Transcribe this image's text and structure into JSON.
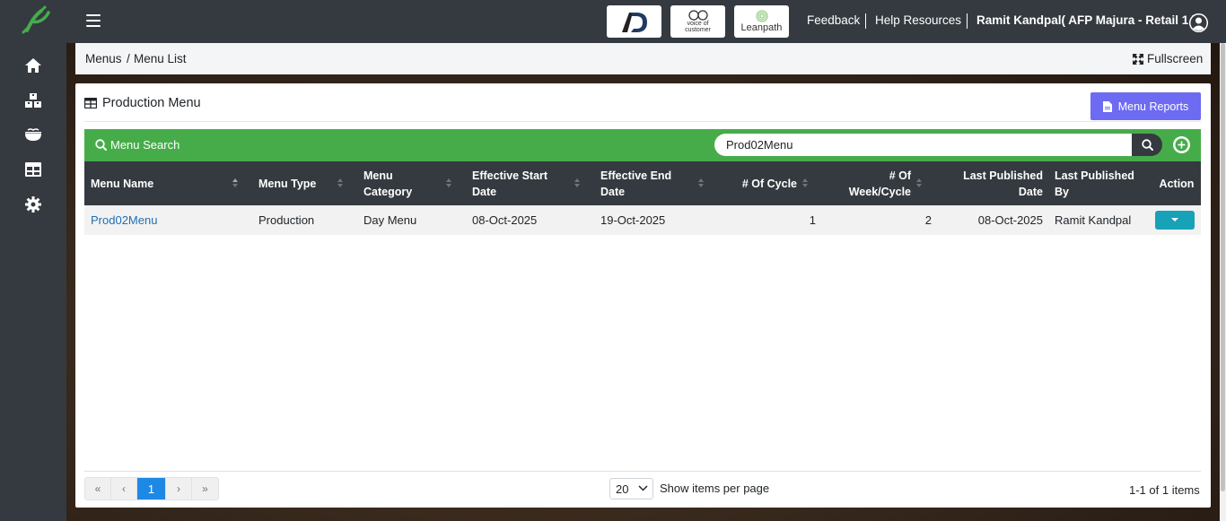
{
  "header": {
    "brand_tiles": [
      {
        "name": "ad-logo",
        "text": ""
      },
      {
        "name": "voice-of-customer-logo",
        "text": "voice of customer"
      },
      {
        "name": "leanpath-logo",
        "text": "Leanpath"
      }
    ],
    "feedback_label": "Feedback",
    "help_label": "Help Resources",
    "user_name": "Ramit Kandpal( AFP Majura - Retail 1 )"
  },
  "sidebar": {
    "items": [
      {
        "icon": "home-icon"
      },
      {
        "icon": "boxes-icon"
      },
      {
        "icon": "food-bowl-icon"
      },
      {
        "icon": "table-icon"
      },
      {
        "icon": "gear-icon"
      }
    ]
  },
  "breadcrumb": {
    "items": [
      "Menus",
      "/",
      "Menu List"
    ],
    "fullscreen_label": "Fullscreen"
  },
  "card": {
    "title": "Production Menu",
    "reports_button": "Menu Reports",
    "search_label": "Menu Search",
    "search_value": "Prod02Menu"
  },
  "table": {
    "columns": [
      "Menu Name",
      "Menu Type",
      "Menu Category",
      "Effective Start Date",
      "Effective End Date",
      "# Of Cycle",
      "# Of Week/Cycle",
      "Last Published Date",
      "Last Published By",
      "Action"
    ],
    "rows": [
      {
        "menu_name": "Prod02Menu",
        "menu_type": "Production",
        "menu_category": "Day Menu",
        "start_date": "08-Oct-2025",
        "end_date": "19-Oct-2025",
        "cycles": "1",
        "weeks_per_cycle": "2",
        "last_published_date": "08-Oct-2025",
        "last_published_by": "Ramit Kandpal"
      }
    ]
  },
  "pager": {
    "first": "«",
    "prev": "‹",
    "current_page": "1",
    "next": "›",
    "last": "»",
    "page_size": "20",
    "page_size_label": "Show items per page",
    "item_count": "1-1 of 1 items"
  },
  "colors": {
    "sidebar": "#343a40",
    "search_bar": "#46ac4a",
    "reports_button": "#6d6bf2",
    "action_button": "#17a2b8",
    "active_page": "#1e88e5",
    "link": "#1f6fb5"
  }
}
